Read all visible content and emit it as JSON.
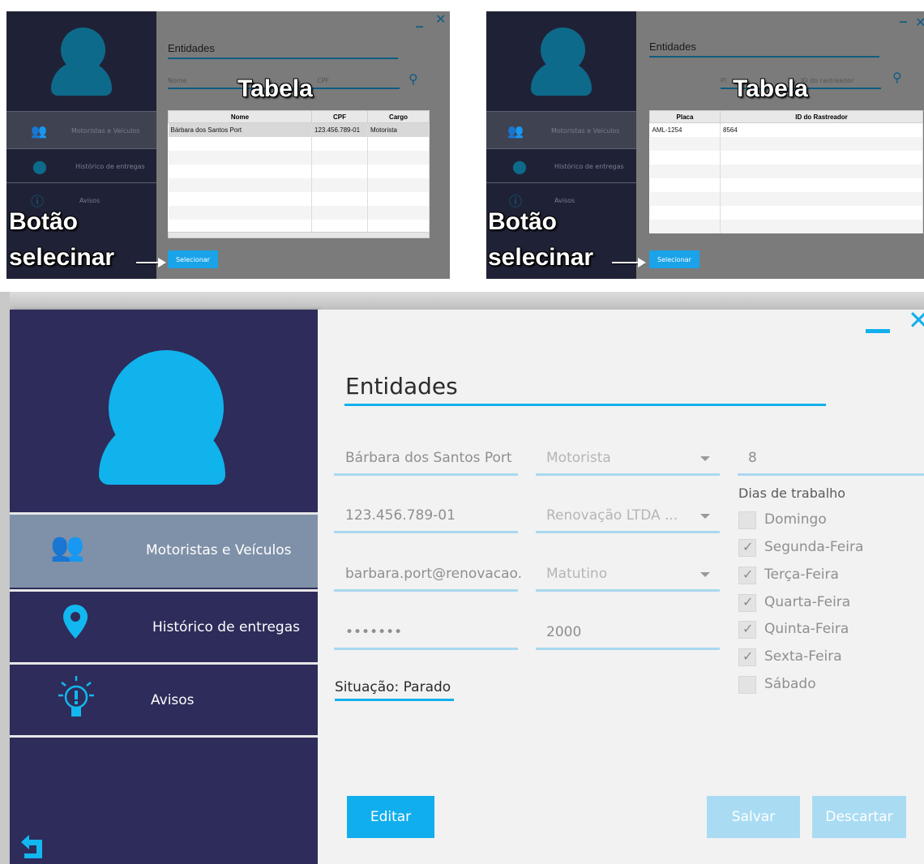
{
  "top_left": {
    "title": "Entidades",
    "search_placeholder": "Nome",
    "search_placeholder_2": "CPF",
    "nav": [
      {
        "label": "Motoristas e Veículos",
        "icon": "users-icon"
      },
      {
        "label": "Histórico de entregas",
        "icon": "map-pin-icon"
      },
      {
        "label": "Avisos",
        "icon": "lightbulb-icon"
      }
    ],
    "columns": [
      "Nome",
      "CPF",
      "Cargo"
    ],
    "rows": [
      [
        "Bárbara dos Santos Port",
        "123.456.789-01",
        "Motorista"
      ]
    ],
    "select_button": "Selecionar"
  },
  "top_right": {
    "title": "Entidades",
    "search_placeholder": "Pl",
    "search_placeholder_2": "ID do rastreador",
    "nav": [
      {
        "label": "Motoristas e Veículos",
        "icon": "users-icon"
      },
      {
        "label": "Histórico de entregas",
        "icon": "map-pin-icon"
      },
      {
        "label": "Avisos",
        "icon": "lightbulb-icon"
      }
    ],
    "columns": [
      "Placa",
      "ID do Rastreador"
    ],
    "rows": [
      [
        "AML-1254",
        "8564"
      ]
    ],
    "select_button": "Selecionar"
  },
  "annotations": {
    "table": "Tabela",
    "button_line1": "Botão",
    "button_line2": "selecinar"
  },
  "form": {
    "title": "Entidades",
    "nav": [
      {
        "label": "Motoristas e Veículos",
        "icon": "users-icon"
      },
      {
        "label": "Histórico de entregas",
        "icon": "map-pin-icon"
      },
      {
        "label": "Avisos",
        "icon": "lightbulb-icon"
      }
    ],
    "name": "Bárbara dos Santos Port",
    "cpf": "123.456.789-01",
    "email": "barbara.port@renovacao.",
    "password": "•••••••",
    "cargo": "Motorista",
    "empresa": "Renovação LTDA ...",
    "turno": "Matutino",
    "valor": "2000",
    "numero": "8",
    "dias_label": "Dias de trabalho",
    "dias": [
      {
        "label": "Domingo",
        "checked": false
      },
      {
        "label": "Segunda-Feira",
        "checked": true
      },
      {
        "label": "Terça-Feira",
        "checked": true
      },
      {
        "label": "Quarta-Feira",
        "checked": true
      },
      {
        "label": "Quinta-Feira",
        "checked": true
      },
      {
        "label": "Sexta-Feira",
        "checked": true
      },
      {
        "label": "Sábado",
        "checked": false
      }
    ],
    "situacao": "Situação: Parado",
    "edit_button": "Editar",
    "save_button": "Salvar",
    "discard_button": "Descartar"
  },
  "colors": {
    "accent": "#12b0ec",
    "sidebar": "#2e2c5a",
    "active_nav": "#7f91a8"
  }
}
